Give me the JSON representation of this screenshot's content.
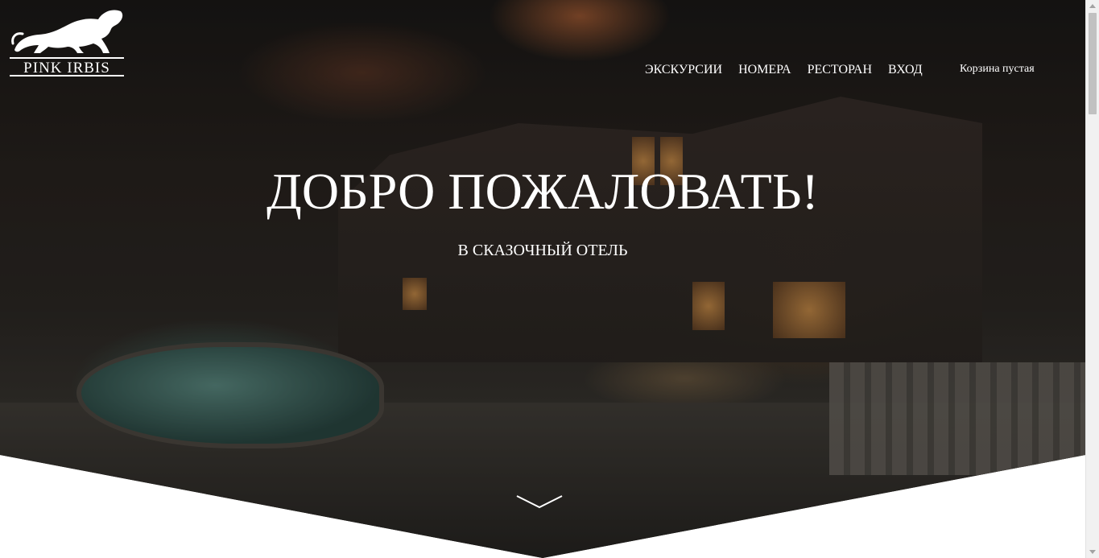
{
  "brand": {
    "name": "PINK IRBIS",
    "logo_icon": "snow-leopard-icon"
  },
  "nav": {
    "items": [
      {
        "label": "ЭКСКУРСИИ"
      },
      {
        "label": "НОМЕРА"
      },
      {
        "label": "РЕСТОРАН"
      },
      {
        "label": "ВХОД"
      }
    ],
    "cart_label": "Корзина пустая"
  },
  "hero": {
    "title": "ДОБРО ПОЖАЛОВАТЬ!",
    "subtitle": "В СКАЗОЧНЫЙ ОТЕЛЬ",
    "scroll_icon": "chevron-down-icon",
    "background": "night-hotel-photo"
  },
  "colors": {
    "text": "#ffffff",
    "page_background": "#ffffff",
    "scrollbar_track": "#f1f1f1",
    "scrollbar_thumb": "#c1c1c1"
  }
}
